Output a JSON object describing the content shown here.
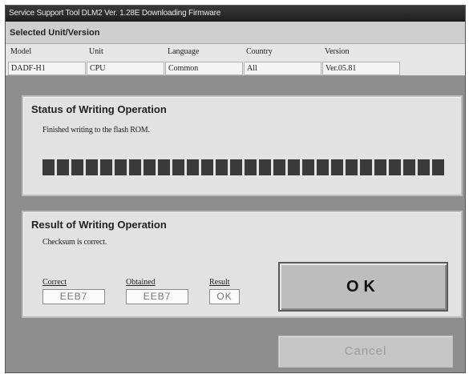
{
  "window": {
    "title": "Service Support Tool DLM2 Ver. 1.28E  Downloading Firmware"
  },
  "selected": {
    "header": "Selected Unit/Version",
    "columns": [
      "Model",
      "Unit",
      "Language",
      "Country",
      "Version"
    ],
    "values": [
      "DADF-H1",
      "CPU",
      "Common",
      "All",
      "Ver.05.81"
    ]
  },
  "status": {
    "title": "Status of Writing Operation",
    "message": "Finished writing to the flash ROM.",
    "progress": 1.0
  },
  "result": {
    "title": "Result of Writing Operation",
    "message": "Checksum is correct.",
    "correct_label": "Correct",
    "correct_value": "EEB7",
    "obtained_label": "Obtained",
    "obtained_value": "EEB7",
    "result_label": "Result",
    "result_value": "OK"
  },
  "buttons": {
    "ok": "OK",
    "cancel": "Cancel"
  }
}
